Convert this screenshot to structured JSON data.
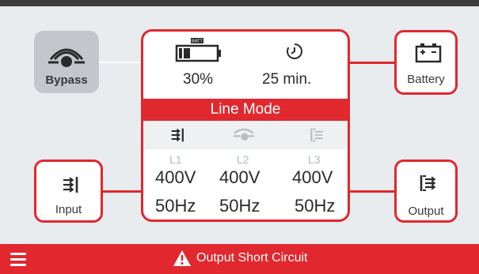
{
  "bypass": {
    "label": "Bypass",
    "icon": "bypass-icon"
  },
  "battery": {
    "label": "Battery",
    "icon": "battery-icon",
    "charge_fraction": 0.3
  },
  "input": {
    "label": "Input",
    "icon": "input-icon"
  },
  "output": {
    "label": "Output",
    "icon": "output-icon"
  },
  "status": {
    "battery_percent": "30%",
    "runtime": "25 min.",
    "battery_icon_text": "BATT",
    "mode": "Line Mode",
    "phases": [
      {
        "label": "L1",
        "voltage": "400V",
        "frequency": "50Hz"
      },
      {
        "label": "L2",
        "voltage": "400V",
        "frequency": "50Hz"
      },
      {
        "label": "L3",
        "voltage": "400V",
        "frequency": "50Hz"
      }
    ]
  },
  "footer": {
    "alarm": "Output Short Circuit",
    "alarm_icon": "warning-icon",
    "menu_icon": "menu-icon"
  },
  "colors": {
    "accent": "#e0282e",
    "background": "#e9ecef",
    "bypass_bg": "#c3c7cb",
    "top_bar": "#3d3d3d"
  }
}
